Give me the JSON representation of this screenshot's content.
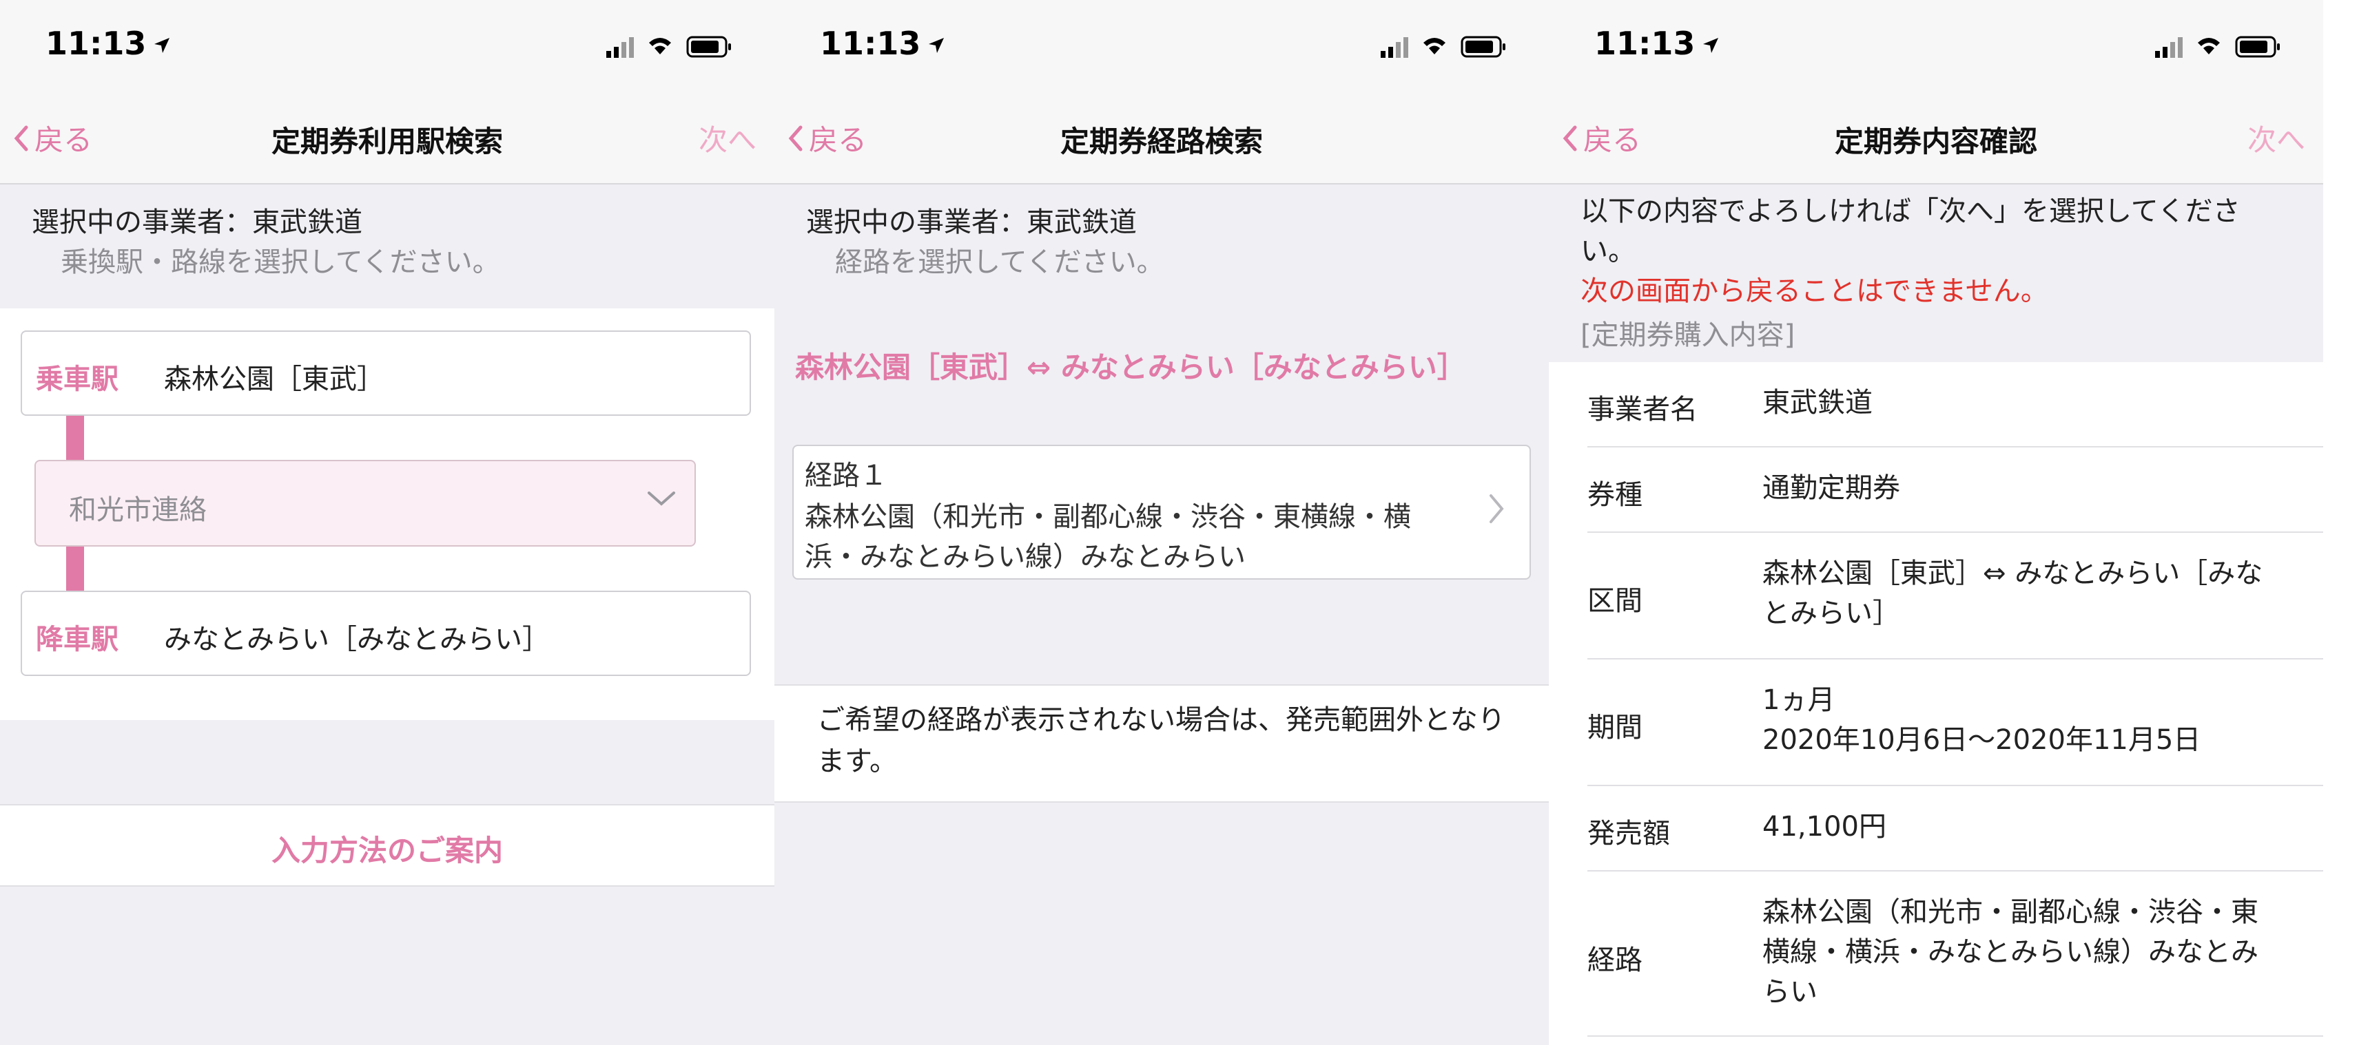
{
  "status": {
    "time": "11:13"
  },
  "panel1": {
    "nav": {
      "back": "戻る",
      "title": "定期券利用駅検索",
      "next": "次へ"
    },
    "operator_line": "選択中の事業者：東武鉄道",
    "instruction": "乗換駅・路線を選択してください。",
    "boarding_label": "乗車駅",
    "boarding_value": "森林公園［東武］",
    "transfer_value": "和光市連絡",
    "alighting_label": "降車駅",
    "alighting_value": "みなとみらい［みなとみらい］",
    "guide_link": "入力方法のご案内"
  },
  "panel2": {
    "nav": {
      "back": "戻る",
      "title": "定期券経路検索"
    },
    "operator_line": "選択中の事業者：東武鉄道",
    "instruction": "経路を選択してください。",
    "route_header": "森林公園［東武］⇔ みなとみらい［みなとみらい］",
    "route_card": {
      "title": "経路１",
      "line1": "森林公園（和光市・副都心線・渋谷・東横線・横",
      "line2": "浜・みなとみらい線）みなとみらい"
    },
    "note": "ご希望の経路が表示されない場合は、発売範囲外となります。"
  },
  "panel3": {
    "nav": {
      "back": "戻る",
      "title": "定期券内容確認",
      "next": "次へ"
    },
    "intro_line1": "以下の内容でよろしければ「次へ」を選択してくださ",
    "intro_line2": "い。",
    "warning": "次の画面から戻ることはできません。",
    "section_label": "[定期券購入内容]",
    "details": [
      {
        "label": "事業者名",
        "value": "東武鉄道"
      },
      {
        "label": "券種",
        "value": "通勤定期券"
      },
      {
        "label": "区間",
        "value": "森林公園［東武］⇔ みなとみらい［みなとみらい］"
      },
      {
        "label": "期間",
        "value_line1": "1ヵ月",
        "value_line2": "2020年10月6日〜2020年11月5日"
      },
      {
        "label": "発売額",
        "value": "41,100円"
      },
      {
        "label": "経路",
        "value": "森林公園（和光市・副都心線・渋谷・東横線・横浜・みなとみらい線）みなとみらい"
      }
    ]
  },
  "colors": {
    "accent": "#e17aa6",
    "accent_light": "#f0a9c6",
    "warning": "#e2322b",
    "background": "#efeff4"
  }
}
